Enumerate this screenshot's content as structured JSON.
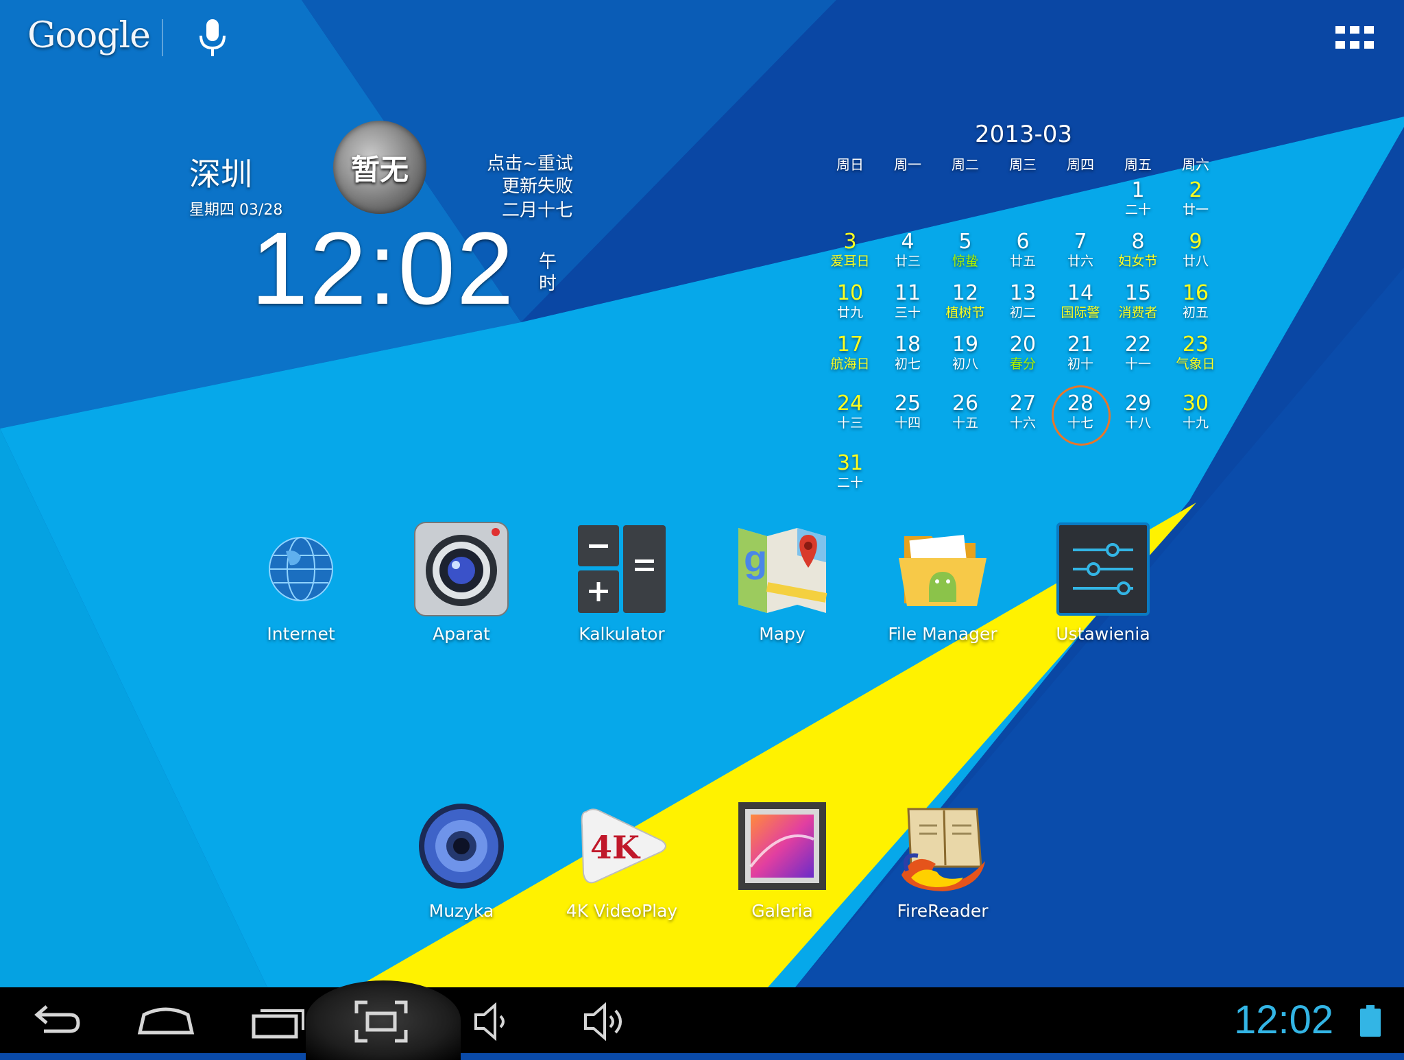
{
  "topbar": {
    "search_logo": "Google"
  },
  "weather": {
    "city": "深圳",
    "date_line": "星期四 03/28",
    "moon_label": "暂无",
    "status_line1": "点击~重试",
    "status_line2": "更新失败",
    "lunar_date": "二月十七",
    "time": "12:02",
    "am_pm_line1": "午",
    "am_pm_line2": "时"
  },
  "calendar": {
    "title": "2013-03",
    "weekdays": [
      "周日",
      "周一",
      "周二",
      "周三",
      "周四",
      "周五",
      "周六"
    ],
    "today": 28,
    "rows": [
      [
        null,
        null,
        null,
        null,
        null,
        {
          "d": "1",
          "s": "二十"
        },
        {
          "d": "2",
          "s": "廿一",
          "dc": "yel"
        }
      ],
      [
        {
          "d": "3",
          "s": "爱耳日",
          "dc": "yel",
          "sc": "yel"
        },
        {
          "d": "4",
          "s": "廿三"
        },
        {
          "d": "5",
          "s": "惊蛰",
          "sc": "grn"
        },
        {
          "d": "6",
          "s": "廿五"
        },
        {
          "d": "7",
          "s": "廿六"
        },
        {
          "d": "8",
          "s": "妇女节",
          "sc": "yel"
        },
        {
          "d": "9",
          "s": "廿八",
          "dc": "yel"
        }
      ],
      [
        {
          "d": "10",
          "s": "廿九",
          "dc": "yel"
        },
        {
          "d": "11",
          "s": "三十"
        },
        {
          "d": "12",
          "s": "植树节",
          "sc": "yel"
        },
        {
          "d": "13",
          "s": "初二"
        },
        {
          "d": "14",
          "s": "国际警",
          "sc": "yel"
        },
        {
          "d": "15",
          "s": "消费者",
          "sc": "yel"
        },
        {
          "d": "16",
          "s": "初五",
          "dc": "yel"
        }
      ],
      [
        {
          "d": "17",
          "s": "航海日",
          "dc": "yel",
          "sc": "yel"
        },
        {
          "d": "18",
          "s": "初七"
        },
        {
          "d": "19",
          "s": "初八"
        },
        {
          "d": "20",
          "s": "春分",
          "sc": "grn"
        },
        {
          "d": "21",
          "s": "初十"
        },
        {
          "d": "22",
          "s": "十一"
        },
        {
          "d": "23",
          "s": "气象日",
          "dc": "yel",
          "sc": "yel"
        }
      ],
      [
        {
          "d": "24",
          "s": "十三",
          "dc": "yel"
        },
        {
          "d": "25",
          "s": "十四"
        },
        {
          "d": "26",
          "s": "十五"
        },
        {
          "d": "27",
          "s": "十六"
        },
        {
          "d": "28",
          "s": "十七"
        },
        {
          "d": "29",
          "s": "十八"
        },
        {
          "d": "30",
          "s": "十九",
          "dc": "yel"
        }
      ],
      [
        {
          "d": "31",
          "s": "二十",
          "dc": "yel"
        },
        null,
        null,
        null,
        null,
        null,
        null
      ]
    ]
  },
  "apps": {
    "internet": "Internet",
    "aparat": "Aparat",
    "kalkulator": "Kalkulator",
    "mapy": "Mapy",
    "file_manager": "File Manager",
    "ustawienia": "Ustawienia",
    "muzyka": "Muzyka",
    "videoplay": "4K VideoPlay",
    "galeria": "Galeria",
    "firereader": "FireReader",
    "videoplay_badge": "4K"
  },
  "navbar": {
    "clock": "12:02",
    "accent_color": "#33b5e5"
  },
  "colors": {
    "wallpaper_light": "#06a8ea",
    "wallpaper_dark": "#0a47a4",
    "highlight_yellow": "#fff200",
    "today_ring": "#e8762a"
  }
}
